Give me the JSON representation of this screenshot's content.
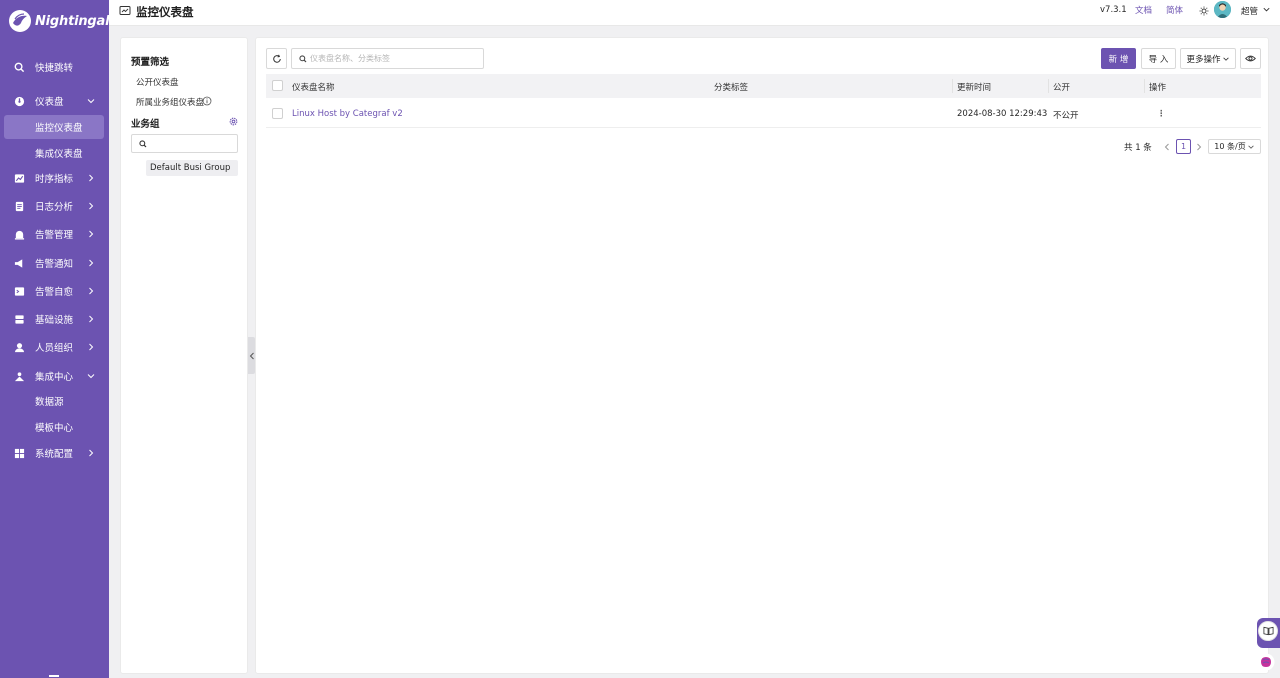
{
  "app": {
    "logo_text": "Nightingale"
  },
  "sidebar": {
    "items": [
      {
        "label": "快捷跳转",
        "icon": "search-icon"
      },
      {
        "label": "仪表盘",
        "icon": "dashboard-icon"
      },
      {
        "label": "监控仪表盘"
      },
      {
        "label": "集成仪表盘"
      },
      {
        "label": "时序指标",
        "icon": "line-chart-icon"
      },
      {
        "label": "日志分析",
        "icon": "log-icon"
      },
      {
        "label": "告警管理",
        "icon": "alarm-icon"
      },
      {
        "label": "告警通知",
        "icon": "notification-icon"
      },
      {
        "label": "告警自愈",
        "icon": "terminal-icon"
      },
      {
        "label": "基础设施",
        "icon": "server-icon"
      },
      {
        "label": "人员组织",
        "icon": "user-icon"
      },
      {
        "label": "集成中心",
        "icon": "integration-icon"
      },
      {
        "label": "数据源"
      },
      {
        "label": "模板中心"
      },
      {
        "label": "系统配置",
        "icon": "settings-icon"
      }
    ],
    "active": "监控仪表盘"
  },
  "header": {
    "title": "监控仪表盘",
    "version": "v7.3.1",
    "docs": "文档",
    "lang": "简体",
    "user": "超管"
  },
  "filter_panel": {
    "preset_title": "预置筛选",
    "public_dashboards": "公开仪表盘",
    "group_dashboards": "所属业务组仪表盘",
    "busi_group_title": "业务组",
    "busi_search_value": "",
    "groups": [
      "Default Busi Group"
    ]
  },
  "toolbar": {
    "search_placeholder": "仪表盘名称、分类标签",
    "new_label": "新 增",
    "import_label": "导 入",
    "more_label": "更多操作"
  },
  "table": {
    "columns": [
      "仪表盘名称",
      "分类标签",
      "更新时间",
      "公开",
      "操作"
    ],
    "rows": [
      {
        "name": "Linux Host by Categraf v2",
        "tags": "",
        "updated": "2024-08-30 12:29:43",
        "public": "不公开",
        "ops": "⋮"
      }
    ]
  },
  "pagination": {
    "total_text": "共 1 条",
    "current_page": "1",
    "page_size": "10 条/页"
  },
  "colors": {
    "brand": "#6c53b1",
    "sidebar_active": "#8a76c6"
  }
}
